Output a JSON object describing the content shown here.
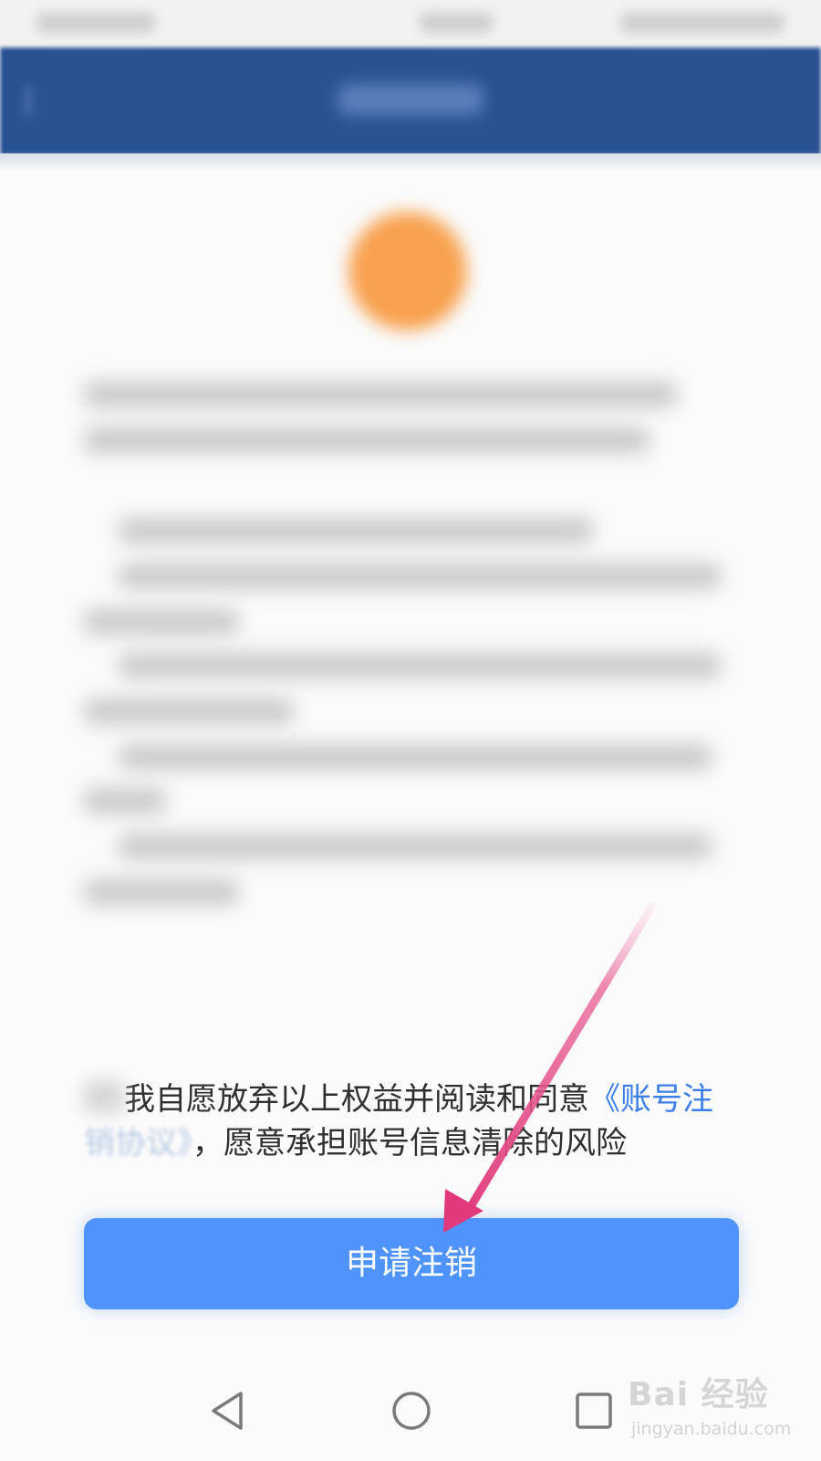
{
  "consent": {
    "text_prefix": "我自愿放弃以上权益并阅读和同意",
    "link_visible": "《账号注",
    "link_faded": "销协议》",
    "text_suffix": "，愿意承担账号信息清除的风险"
  },
  "apply_button": {
    "label": "申请注销"
  },
  "colors": {
    "header": "#295293",
    "button": "#4f94fc",
    "link": "#3a7eea",
    "warning_icon": "#f8a14e",
    "arrow": "#e13a7c"
  },
  "nav": {
    "back_icon": "triangle-back-icon",
    "home_icon": "circle-home-icon",
    "recents_icon": "square-recents-icon"
  },
  "watermark": {
    "main": "Bai 经验",
    "sub": "jingyan.baidu.com"
  }
}
